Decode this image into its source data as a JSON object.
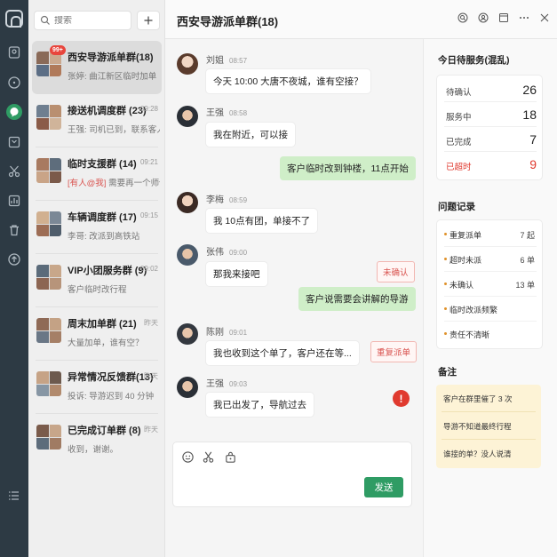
{
  "search": {
    "placeholder": "搜索"
  },
  "sessions": [
    {
      "name": "西安导游派单群(18)",
      "time": "",
      "preview": "张婷: 曲江新区临时加单",
      "badge": "99+",
      "active": true
    },
    {
      "name": "接送机调度群 (23)",
      "time": "09:28",
      "preview": "王强: 司机已到，联系客人"
    },
    {
      "name": "临时支援群 (14)",
      "time": "09:21",
      "preview_tag": "[有人@我]",
      "preview": " 需要再一个师傅支援"
    },
    {
      "name": "车辆调度群 (17)",
      "time": "09:15",
      "preview": "李哥: 改派到高铁站"
    },
    {
      "name": "VIP小团服务群 (9)",
      "time": "09:02",
      "preview": "客户临时改行程"
    },
    {
      "name": "周末加单群 (21)",
      "time": "昨天",
      "preview": "大量加单，谁有空？"
    },
    {
      "name": "异常情况反馈群(13)",
      "time": "昨天",
      "preview": "投诉: 导游迟到 40 分钟"
    },
    {
      "name": "已完成订单群 (8)",
      "time": "昨天",
      "preview": "收到，谢谢。"
    }
  ],
  "chat": {
    "title": "西安导游派单群(18)",
    "messages": [
      {
        "sender": "刘姐",
        "time": "08:57",
        "text": "今天 10:00 大唐不夜城，谁有空接？"
      },
      {
        "sender": "王强",
        "time": "08:58",
        "text": "我在附近，可以接"
      },
      {
        "mine": true,
        "text": "客户临时改到钟楼，11点开始"
      },
      {
        "sender": "李梅",
        "time": "08:59",
        "text": "我 10点有团，单接不了"
      },
      {
        "sender": "张伟",
        "time": "09:00",
        "text": "那我来接吧",
        "tag": "未确认"
      },
      {
        "mine": true,
        "text": "客户说需要会讲解的导游"
      },
      {
        "sender": "陈刚",
        "time": "09:01",
        "text": "我也收到这个单了，客户还在等...",
        "tag": "重复派单"
      },
      {
        "sender": "王强",
        "time": "09:03",
        "text": "我已出发了，导航过去",
        "alert": "!"
      }
    ],
    "send_label": "发送"
  },
  "today": {
    "title": "今日待服务(混乱)",
    "stats": [
      {
        "label": "待确认",
        "value": "26"
      },
      {
        "label": "服务中",
        "value": "18"
      },
      {
        "label": "已完成",
        "value": "7"
      },
      {
        "label": "已超时",
        "value": "9",
        "overdue": true
      }
    ]
  },
  "issues": {
    "title": "问题记录",
    "items": [
      {
        "label": "重复派单",
        "count": "7 起"
      },
      {
        "label": "超时未派",
        "count": "6 单"
      },
      {
        "label": "未确认",
        "count": "13 单"
      },
      {
        "label": "临时改派频繁",
        "count": ""
      },
      {
        "label": "责任不清晰",
        "count": ""
      }
    ]
  },
  "notes": {
    "title": "备注",
    "items": [
      "客户在群里催了 3 次",
      "导游不知道最终行程",
      "谁接的单？没人说清"
    ]
  },
  "colors": {
    "rail": "#2d3a44",
    "accent": "#2f9c64",
    "danger": "#e03a2f",
    "my_bubble": "#cfeec8",
    "note_bg": "#fdf3d6"
  }
}
